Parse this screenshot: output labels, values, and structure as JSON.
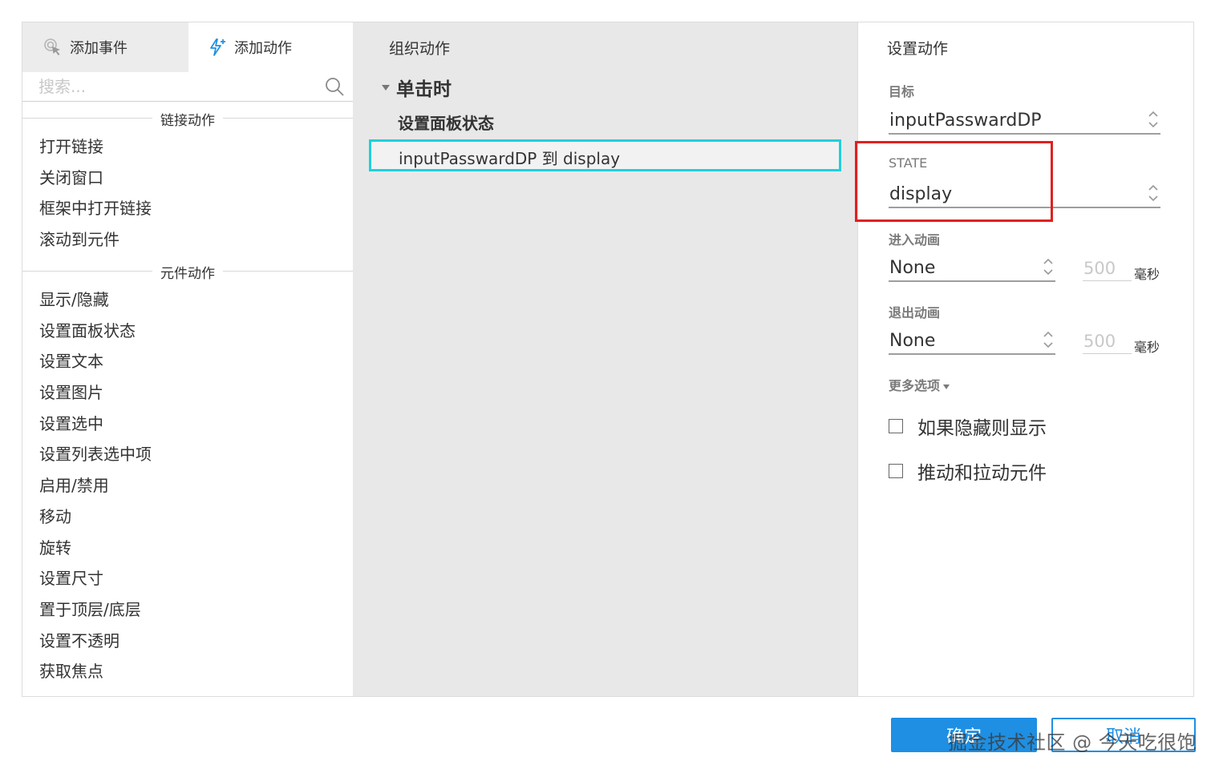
{
  "tabs": {
    "add_event": "添加事件",
    "add_action": "添加动作"
  },
  "search": {
    "placeholder": "搜索..."
  },
  "sections": {
    "link_actions": "链接动作",
    "widget_actions": "元件动作"
  },
  "link_actions": [
    "打开链接",
    "关闭窗口",
    "框架中打开链接",
    "滚动到元件"
  ],
  "widget_actions": [
    "显示/隐藏",
    "设置面板状态",
    "设置文本",
    "设置图片",
    "设置选中",
    "设置列表选中项",
    "启用/禁用",
    "移动",
    "旋转",
    "设置尺寸",
    "置于顶层/底层",
    "设置不透明",
    "获取焦点"
  ],
  "organize": {
    "title": "组织动作",
    "event": "单击时",
    "action": "设置面板状态",
    "selected_item": "inputPasswardDP 到 display"
  },
  "config": {
    "title": "设置动作",
    "target_label": "目标",
    "target_value": "inputPasswardDP",
    "state_label": "STATE",
    "state_value": "display",
    "enter_anim_label": "进入动画",
    "enter_anim_value": "None",
    "enter_ms": "500",
    "exit_anim_label": "退出动画",
    "exit_anim_value": "None",
    "exit_ms": "500",
    "ms_unit": "毫秒",
    "more_options": "更多选项",
    "checkbox_show_if_hidden": "如果隐藏则显示",
    "checkbox_push_pull": "推动和拉动元件"
  },
  "buttons": {
    "ok": "确定",
    "cancel": "取消"
  },
  "watermark": "掘金技术社区 @ 今天吃很饱",
  "colors": {
    "accent": "#1e8fe3",
    "selection_border": "#1fd0dc",
    "highlight_box": "#e02020"
  }
}
